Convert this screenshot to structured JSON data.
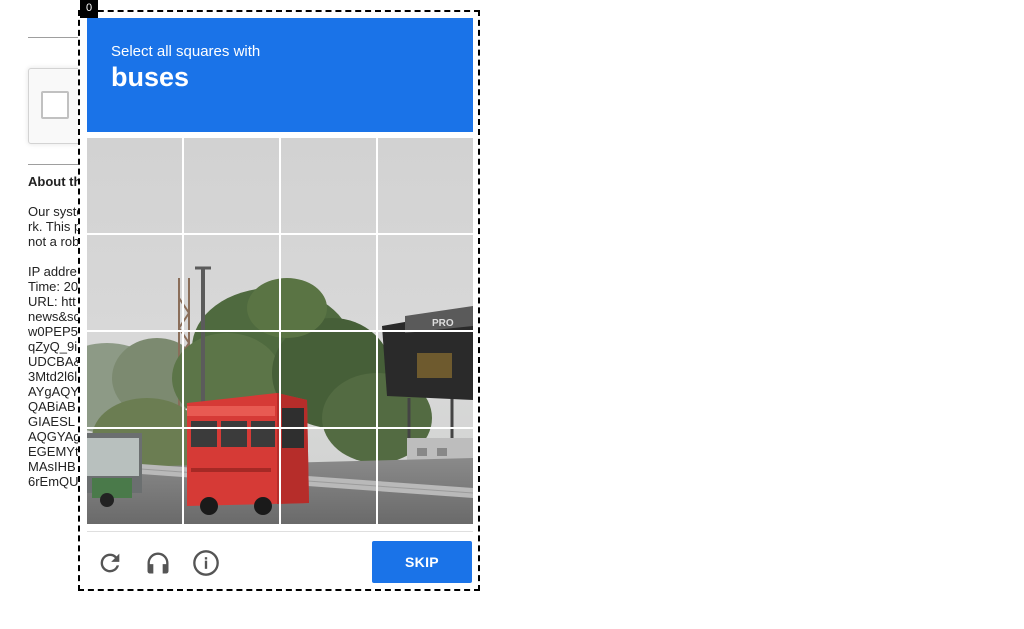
{
  "background_page": {
    "about_heading": "About th",
    "lines": [
      "Our syste",
      "rk. This p",
      "not a rob",
      "",
      "IP addre",
      "Time: 20",
      "URL: htt",
      "news&sc",
      "w0PEP5",
      "qZyQ_9i",
      "UDCBA&",
      "3Mtd2l6l",
      "AYgAQY",
      "QABiAB",
      "GIAESL",
      "AQGYAg",
      "EGEMYt",
      "MAsIHB",
      "6rEmQU"
    ]
  },
  "challenge": {
    "frame_index": "0",
    "instruction": "Select all squares with",
    "target_object": "buses",
    "grid_rows": 4,
    "grid_cols": 4,
    "billboard_text": "PRO",
    "footer": {
      "reload_icon": "reload-icon",
      "audio_icon": "headphones-icon",
      "info_icon": "info-icon",
      "skip_label": "Skip"
    }
  },
  "colors": {
    "header_bg": "#1a73e8",
    "button_bg": "#1a73e8",
    "bus_red": "#d63a36",
    "icon_gray": "#555555"
  }
}
